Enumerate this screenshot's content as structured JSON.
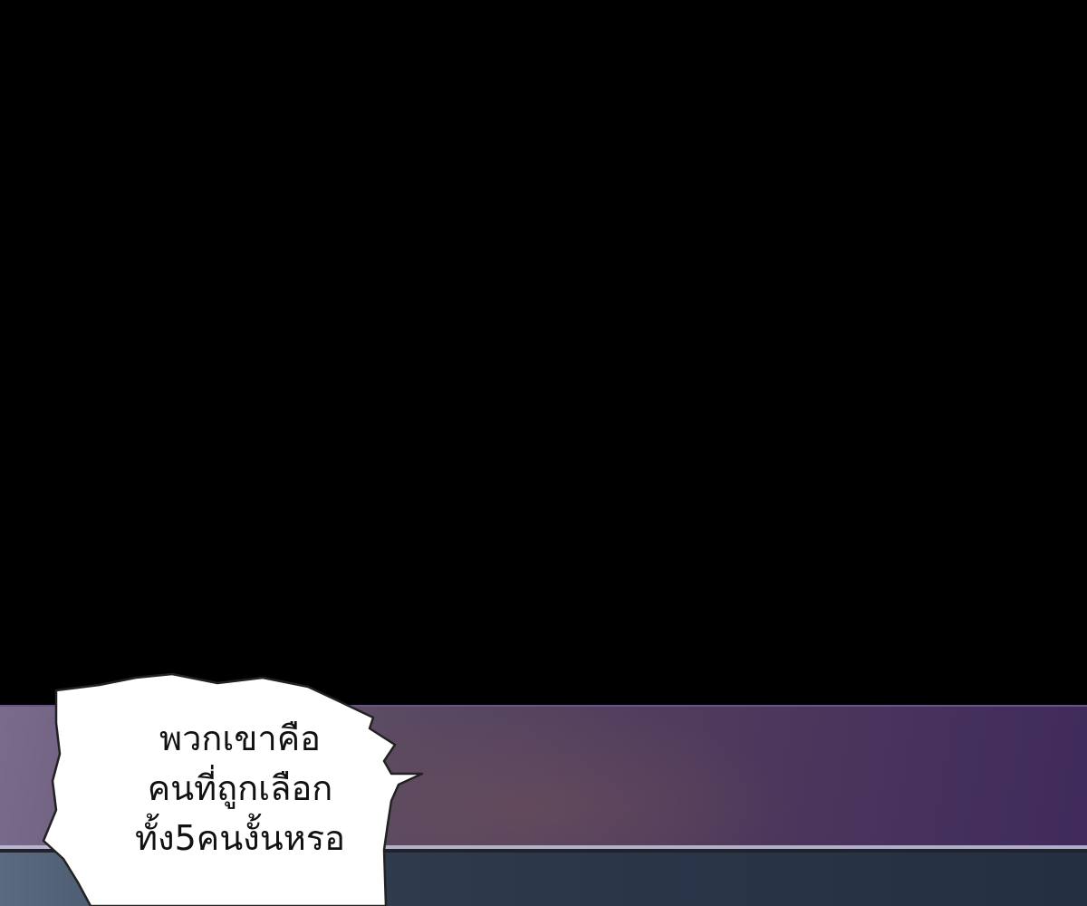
{
  "speech_bubble": {
    "lines": [
      "พวกเขาคือ",
      "คนที่ถูกเลือก",
      "ทั้ง5คนงั้นหรอ"
    ]
  },
  "colors": {
    "background": "#000000",
    "scene_purple": "#4e3a5c",
    "bubble_fill": "#ffffff",
    "bubble_outline": "#222222"
  }
}
